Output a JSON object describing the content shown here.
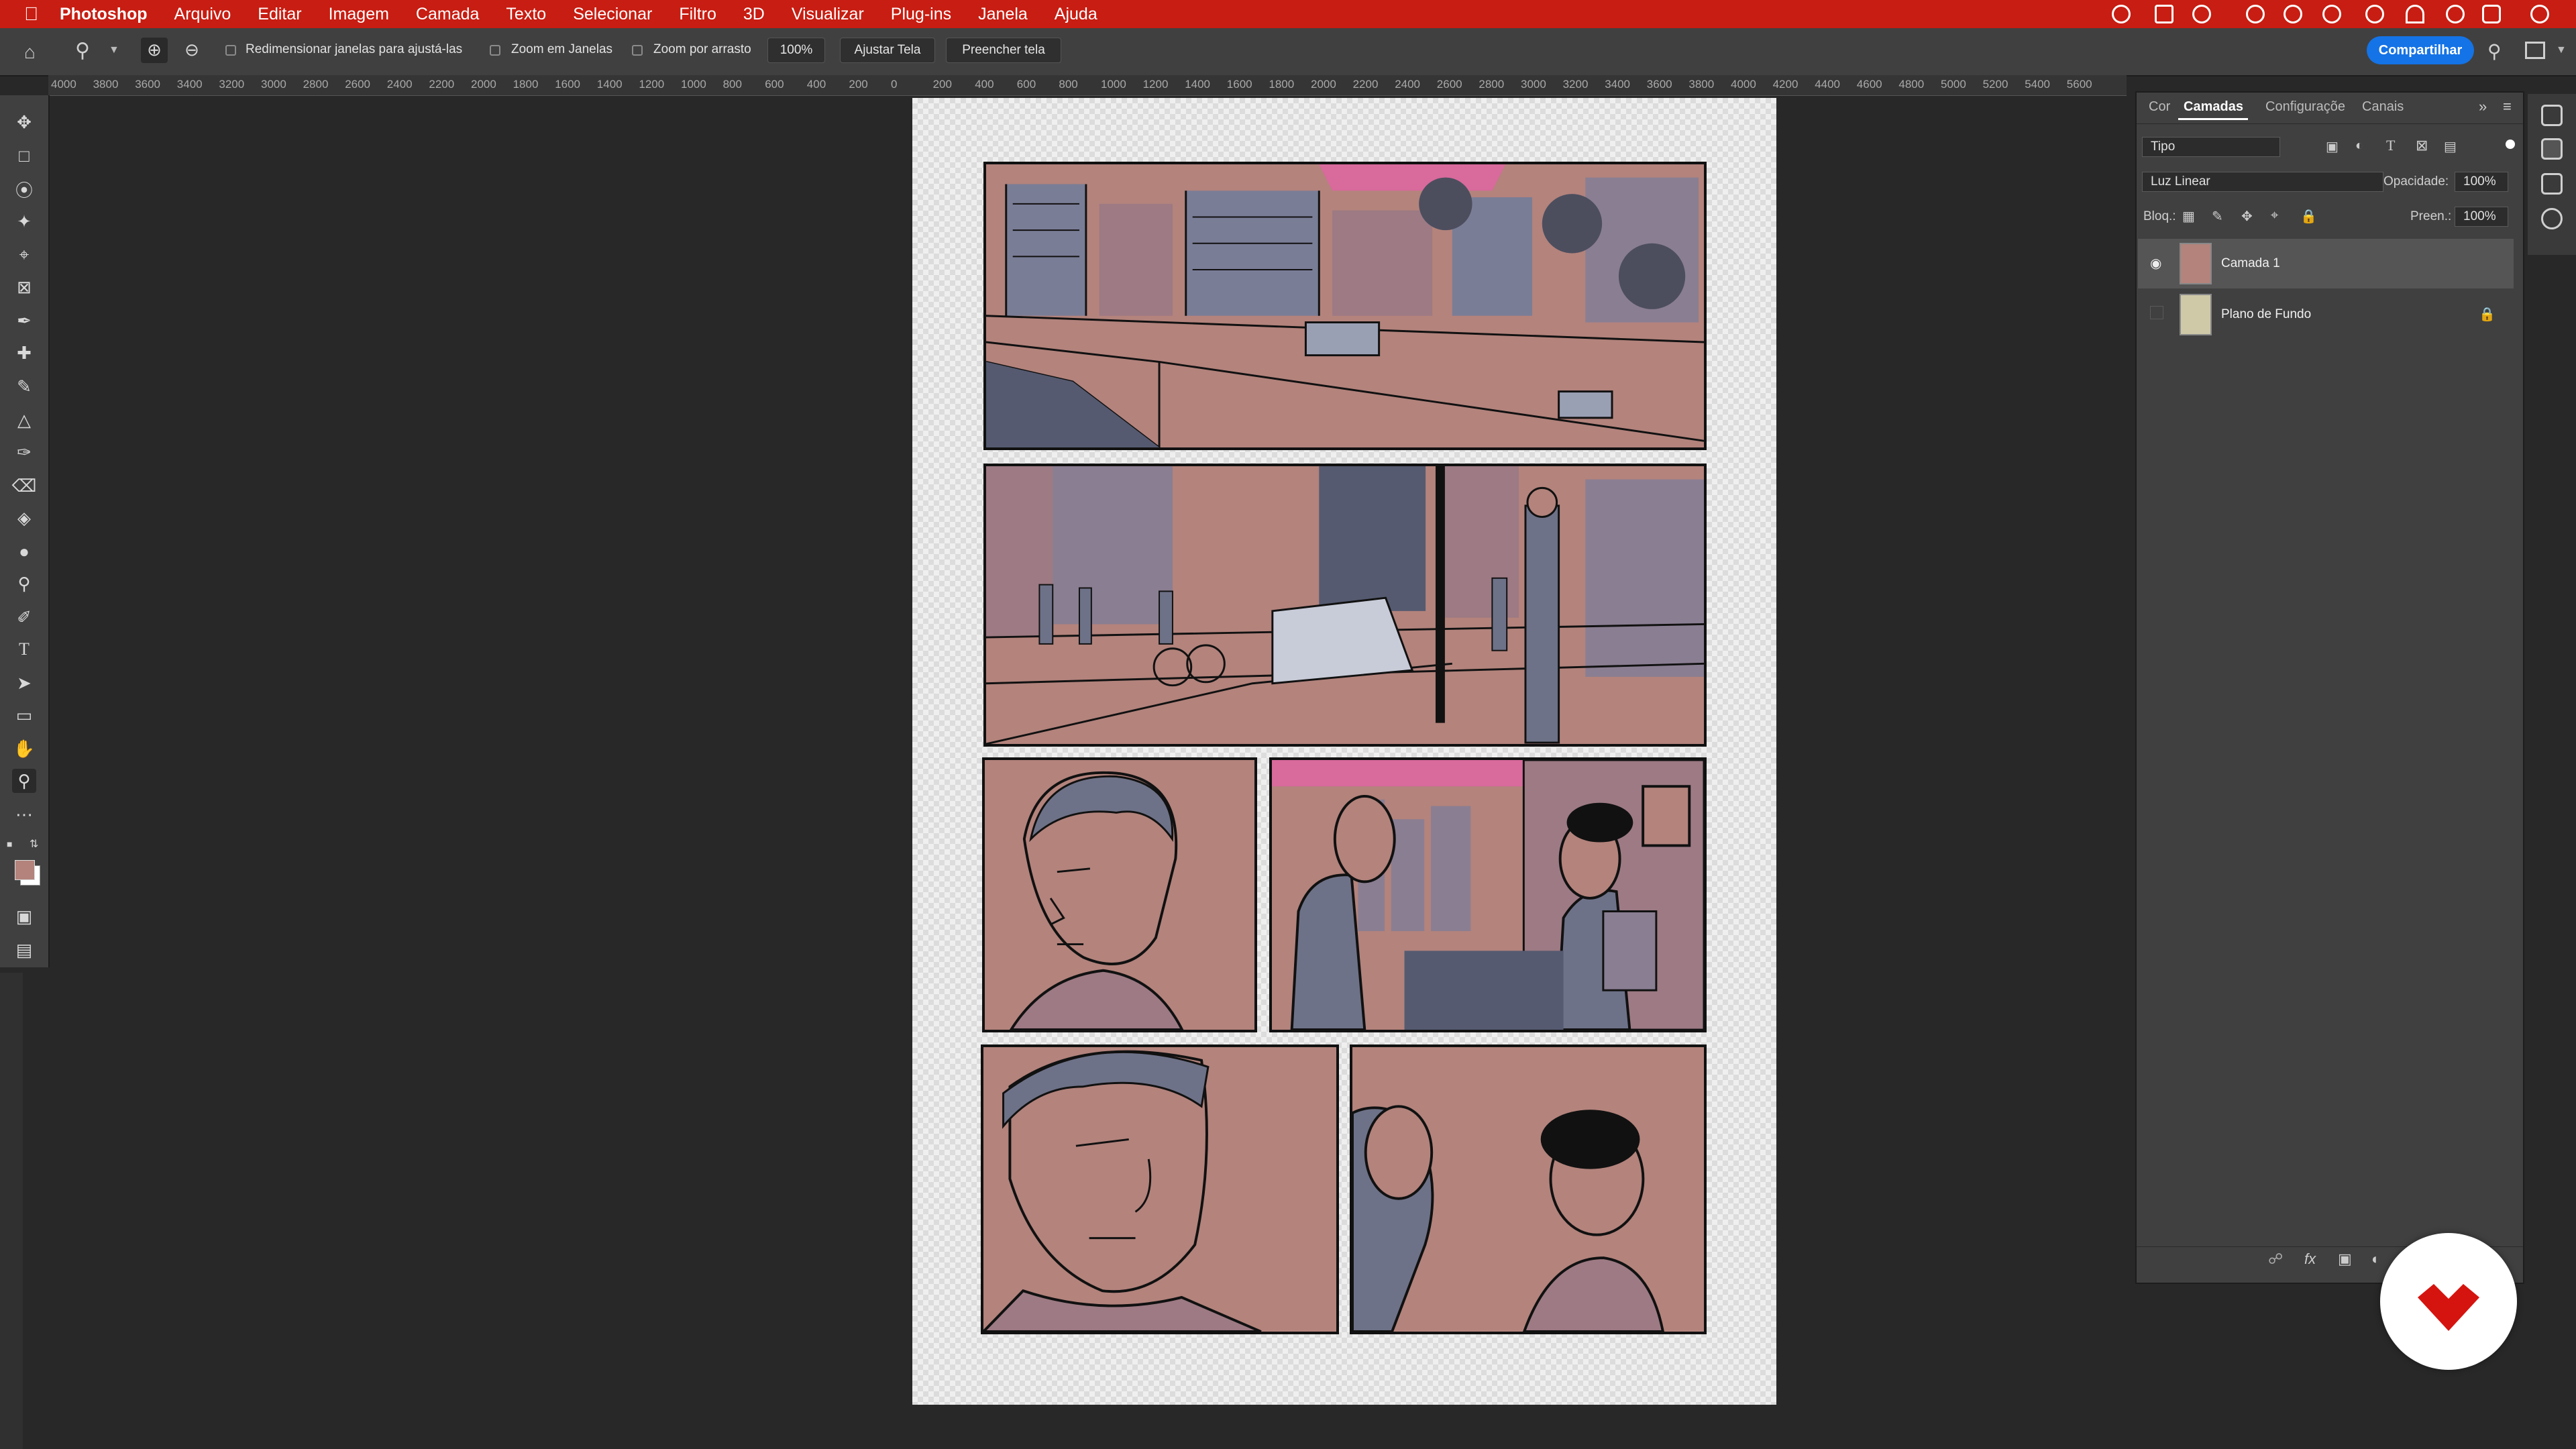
{
  "menubar": {
    "app_name": "Photoshop",
    "items": [
      "Arquivo",
      "Editar",
      "Imagem",
      "Camada",
      "Texto",
      "Selecionar",
      "Filtro",
      "3D",
      "Visualizar",
      "Plug-ins",
      "Janela",
      "Ajuda"
    ]
  },
  "options_bar": {
    "resize_windows_label": "Redimensionar janelas para ajustá-las",
    "zoom_all_windows_label": "Zoom em Janelas",
    "scrubby_zoom_label": "Zoom por arrasto",
    "zoom_value": "100%",
    "fit_screen_label": "Ajustar Tela",
    "fill_screen_label": "Preencher tela",
    "share_label": "Compartilhar"
  },
  "ruler": {
    "ticks": [
      "4000",
      "3800",
      "3600",
      "3400",
      "3200",
      "3000",
      "2800",
      "2600",
      "2400",
      "2200",
      "2000",
      "1800",
      "1600",
      "1400",
      "1200",
      "1000",
      "800",
      "600",
      "400",
      "200",
      "0",
      "200",
      "400",
      "600",
      "800",
      "1000",
      "1200",
      "1400",
      "1600",
      "1800",
      "2000",
      "2200",
      "2400",
      "2600",
      "2800",
      "3000",
      "3200",
      "3400",
      "3600",
      "3800",
      "4000",
      "4200",
      "4400",
      "4600",
      "4800",
      "5000",
      "5200",
      "5400",
      "5600"
    ]
  },
  "layers_panel": {
    "tabs": [
      "Cor",
      "Camadas",
      "Configuraçõe",
      "Canais"
    ],
    "active_tab": "Camadas",
    "filter_kind": "Tipo",
    "blend_mode": "Luz Linear",
    "opacity_label": "Opacidade:",
    "opacity_value": "100%",
    "lock_label": "Bloq.:",
    "fill_label": "Preen.:",
    "fill_value": "100%",
    "layers": [
      {
        "name": "Camada 1",
        "visible": true,
        "selected": true
      },
      {
        "name": "Plano de Fundo",
        "visible": false,
        "locked": true
      }
    ]
  },
  "colors": {
    "accent": "#c81d12",
    "foreground_swatch": "#b3837c",
    "background_swatch": "#ffffff",
    "share_button": "#1473e6"
  }
}
